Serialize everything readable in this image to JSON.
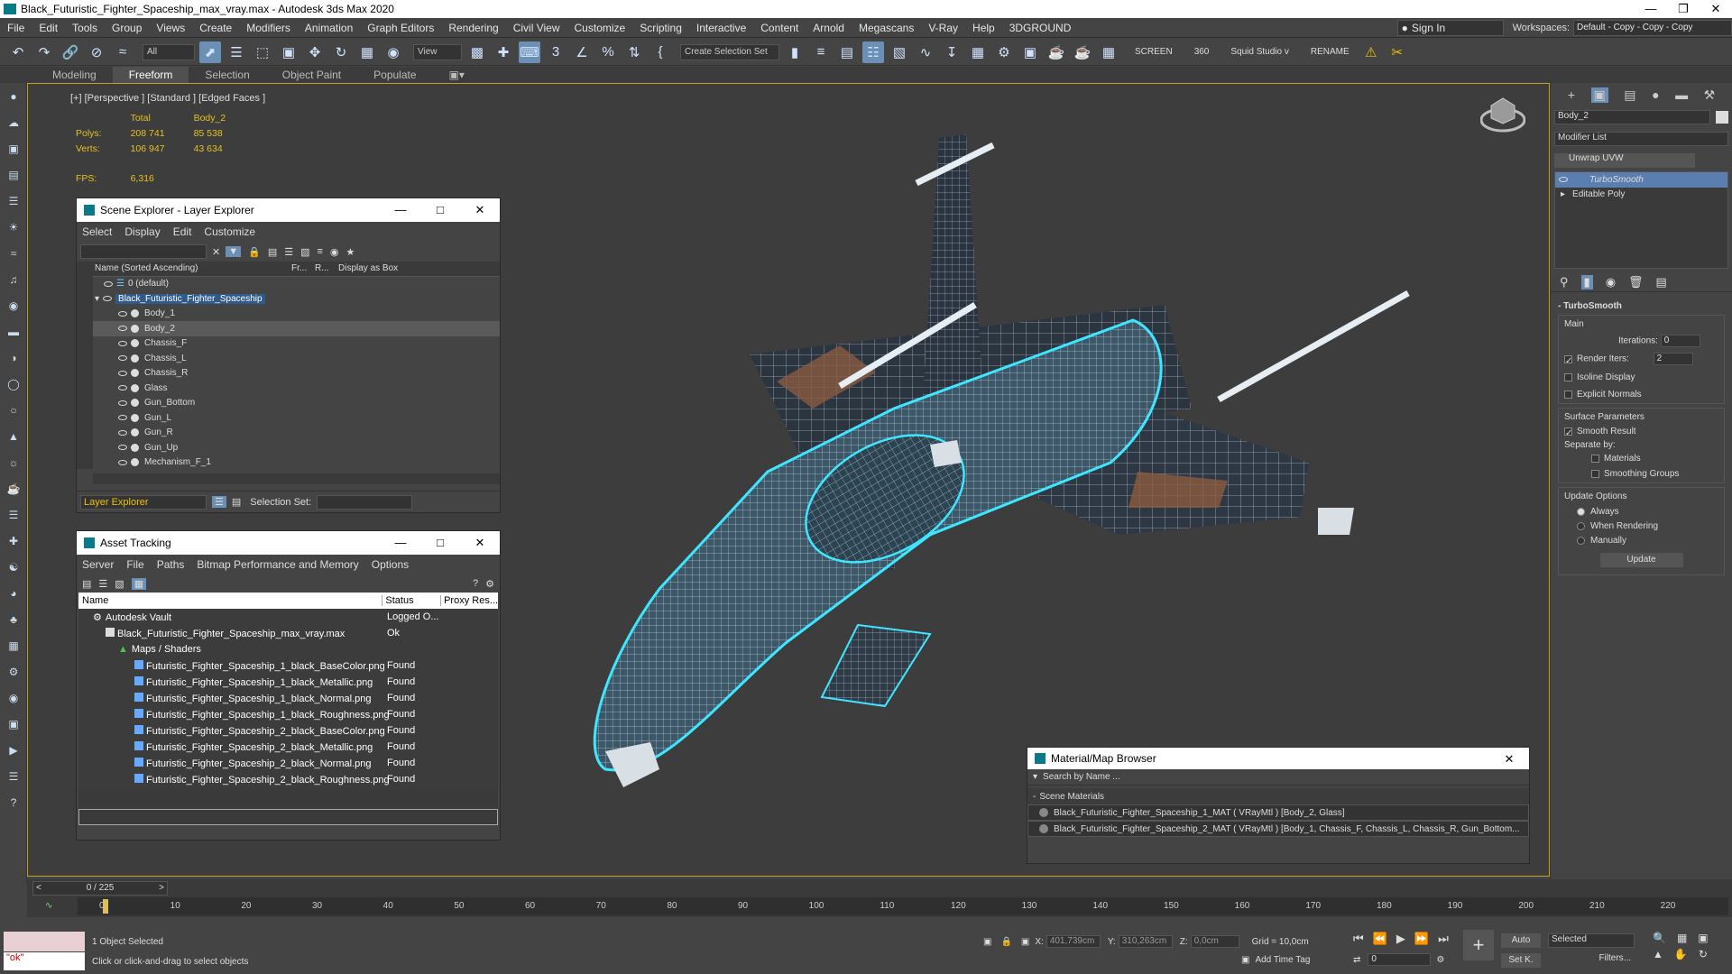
{
  "title": "Black_Futuristic_Fighter_Spaceship_max_vray.max - Autodesk 3ds Max 2020",
  "menu": [
    "File",
    "Edit",
    "Tools",
    "Group",
    "Views",
    "Create",
    "Modifiers",
    "Animation",
    "Graph Editors",
    "Rendering",
    "Civil View",
    "Customize",
    "Scripting",
    "Interactive",
    "Content",
    "Arnold",
    "Megascans",
    "V-Ray",
    "Help",
    "3DGROUND"
  ],
  "signin": "Sign In",
  "workspaces_label": "Workspaces:",
  "workspaces_value": "Default - Copy - Copy - Copy",
  "toolbar": {
    "filter": "All",
    "refcoord": "View",
    "selset": "Create Selection Set",
    "screen": "SCREEN",
    "n360": "360",
    "squid": "Squid Studio v",
    "rename": "RENAME"
  },
  "ribbon_tabs": [
    "Modeling",
    "Freeform",
    "Selection",
    "Object Paint",
    "Populate"
  ],
  "viewport_label": "[+] [Perspective ] [Standard ] [Edged Faces ]",
  "stats": {
    "total_label": "Total",
    "obj_label": "Body_2",
    "polys_label": "Polys:",
    "polys_total": "208 741",
    "polys_obj": "85 538",
    "verts_label": "Verts:",
    "verts_total": "106 947",
    "verts_obj": "43 634",
    "fps_label": "FPS:",
    "fps": "6,316"
  },
  "scene_explorer": {
    "title": "Scene Explorer - Layer Explorer",
    "menu": [
      "Select",
      "Display",
      "Edit",
      "Customize"
    ],
    "col_name": "Name (Sorted Ascending)",
    "col_fr": "Fr...",
    "col_r": "R...",
    "col_box": "Display as Box",
    "layer": "0 (default)",
    "group": "Black_Futuristic_Fighter_Spaceship",
    "items": [
      "Body_1",
      "Body_2",
      "Chassis_F",
      "Chassis_L",
      "Chassis_R",
      "Glass",
      "Gun_Bottom",
      "Gun_L",
      "Gun_R",
      "Gun_Up",
      "Mechanism_F_1"
    ],
    "footer_left": "Layer Explorer",
    "footer_selset": "Selection Set:"
  },
  "asset_tracking": {
    "title": "Asset Tracking",
    "menu": [
      "Server",
      "File",
      "Paths",
      "Bitmap Performance and Memory",
      "Options"
    ],
    "cols": [
      "Name",
      "Status",
      "Proxy Res..."
    ],
    "rows": [
      [
        "Autodesk Vault",
        "Logged O..."
      ],
      [
        "Black_Futuristic_Fighter_Spaceship_max_vray.max",
        "Ok"
      ],
      [
        "Maps / Shaders",
        ""
      ],
      [
        "Futuristic_Fighter_Spaceship_1_black_BaseColor.png",
        "Found"
      ],
      [
        "Futuristic_Fighter_Spaceship_1_black_Metallic.png",
        "Found"
      ],
      [
        "Futuristic_Fighter_Spaceship_1_black_Normal.png",
        "Found"
      ],
      [
        "Futuristic_Fighter_Spaceship_1_black_Roughness.png",
        "Found"
      ],
      [
        "Futuristic_Fighter_Spaceship_2_black_BaseColor.png",
        "Found"
      ],
      [
        "Futuristic_Fighter_Spaceship_2_black_Metallic.png",
        "Found"
      ],
      [
        "Futuristic_Fighter_Spaceship_2_black_Normal.png",
        "Found"
      ],
      [
        "Futuristic_Fighter_Spaceship_2_black_Roughness.png",
        "Found"
      ]
    ]
  },
  "material_browser": {
    "title": "Material/Map Browser",
    "search": "Search by Name ...",
    "section": "Scene Materials",
    "mats": [
      "Black_Futuristic_Fighter_Spaceship_1_MAT  ( VRayMtl )  [Body_2, Glass]",
      "Black_Futuristic_Fighter_Spaceship_2_MAT  ( VRayMtl )  [Body_1, Chassis_F, Chassis_L, Chassis_R, Gun_Bottom..."
    ]
  },
  "cmd": {
    "objname": "Body_2",
    "modlist": "Modifier List",
    "unwrap": "Unwrap UVW",
    "stack": [
      "TurboSmooth",
      "Editable Poly"
    ],
    "ts_title": "TurboSmooth",
    "main": "Main",
    "iterations": "Iterations:",
    "iter_val": "0",
    "render_iters": "Render Iters:",
    "render_val": "2",
    "isoline": "Isoline Display",
    "explicit": "Explicit Normals",
    "surface": "Surface Parameters",
    "smooth": "Smooth Result",
    "separate": "Separate by:",
    "materials": "Materials",
    "smgroups": "Smoothing Groups",
    "update_opts": "Update Options",
    "always": "Always",
    "when_rendering": "When Rendering",
    "manually": "Manually",
    "update_btn": "Update"
  },
  "timeline": {
    "frame": "0 / 225",
    "ticks": [
      "0",
      "10",
      "20",
      "30",
      "40",
      "50",
      "60",
      "70",
      "80",
      "90",
      "100",
      "110",
      "120",
      "130",
      "140",
      "150",
      "160",
      "170",
      "180",
      "190",
      "200",
      "210",
      "220"
    ]
  },
  "status": {
    "maxscript": "\"ok\"",
    "selected": "1 Object Selected",
    "prompt": "Click or click-and-drag to select objects",
    "x_label": "X:",
    "x": "401,739cm",
    "y_label": "Y:",
    "y": "310,263cm",
    "z_label": "Z:",
    "z": "0,0cm",
    "grid": "Grid = 10,0cm",
    "addtime": "Add Time Tag",
    "auto": "Auto",
    "setk": "Set K.",
    "selected_dd": "Selected",
    "filters": "Filters...",
    "frame_val": "0"
  }
}
